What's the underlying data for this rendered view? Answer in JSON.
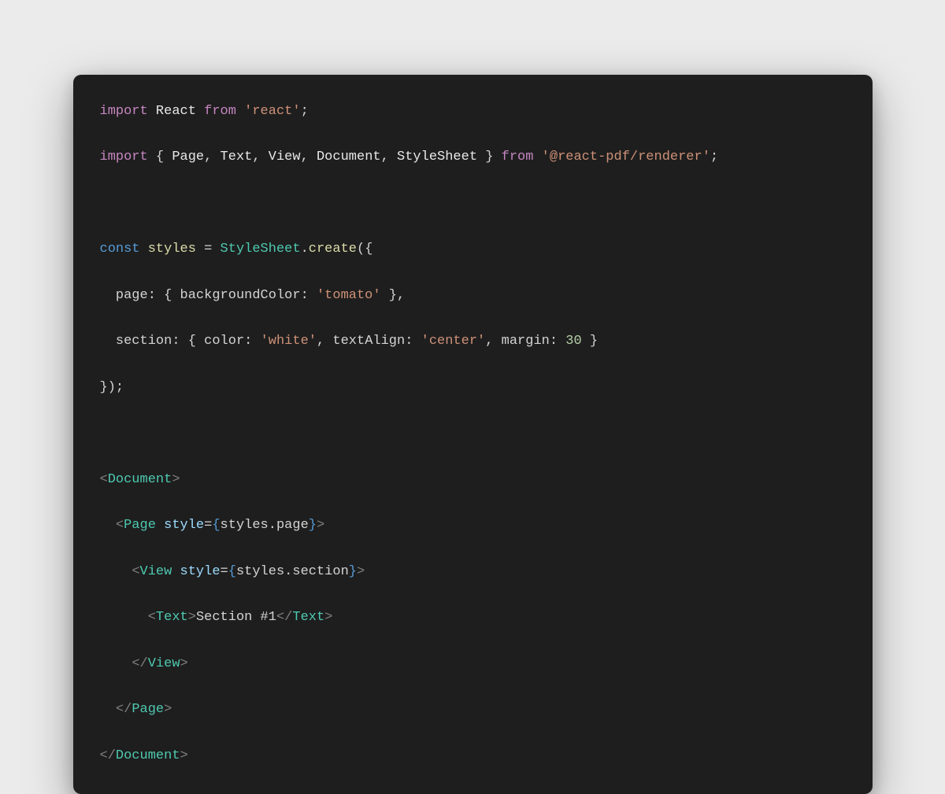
{
  "code": {
    "line1": {
      "import": "import",
      "react": "React",
      "from": "from",
      "str": "'react'",
      "semi": ";"
    },
    "line2": {
      "import": "import",
      "lbrace": "{",
      "page": "Page",
      "c1": ",",
      "text": "Text",
      "c2": ",",
      "view": "View",
      "c3": ",",
      "document": "Document",
      "c4": ",",
      "stylesheet": "StyleSheet",
      "rbrace": "}",
      "from": "from",
      "str": "'@react-pdf/renderer'",
      "semi": ";"
    },
    "line4": {
      "const": "const",
      "styles": "styles",
      "eq": "=",
      "stylesheet": "StyleSheet",
      "dot": ".",
      "create": "create",
      "open": "({"
    },
    "line5": {
      "indent": "  ",
      "page": "page",
      "colon": ":",
      "lbrace": "{",
      "bg": "backgroundColor",
      "colon2": ":",
      "tomato": "'tomato'",
      "rbrace": "}",
      "comma": ","
    },
    "line6": {
      "indent": "  ",
      "section": "section",
      "colon": ":",
      "lbrace": "{",
      "color": "color",
      "colon2": ":",
      "white": "'white'",
      "c1": ",",
      "ta": "textAlign",
      "colon3": ":",
      "center": "'center'",
      "c2": ",",
      "margin": "margin",
      "colon4": ":",
      "num": "30",
      "rbrace": "}"
    },
    "line7": {
      "close": "});"
    },
    "line9": {
      "lt": "<",
      "doc": "Document",
      "gt": ">"
    },
    "line10": {
      "indent": "  ",
      "lt": "<",
      "page": "Page",
      "sp": " ",
      "style": "style",
      "eq": "=",
      "lbrace": "{",
      "styles": "styles",
      "dot": ".",
      "pageprop": "page",
      "rbrace": "}",
      "gt": ">"
    },
    "line11": {
      "indent": "    ",
      "lt": "<",
      "view": "View",
      "sp": " ",
      "style": "style",
      "eq": "=",
      "lbrace": "{",
      "styles": "styles",
      "dot": ".",
      "section": "section",
      "rbrace": "}",
      "gt": ">"
    },
    "line12": {
      "indent": "      ",
      "lt": "<",
      "text": "Text",
      "gt": ">",
      "content": "Section #1",
      "lt2": "</",
      "text2": "Text",
      "gt2": ">"
    },
    "line13": {
      "indent": "    ",
      "lt": "</",
      "view": "View",
      "gt": ">"
    },
    "line14": {
      "indent": "  ",
      "lt": "</",
      "page": "Page",
      "gt": ">"
    },
    "line15": {
      "lt": "</",
      "doc": "Document",
      "gt": ">"
    }
  }
}
